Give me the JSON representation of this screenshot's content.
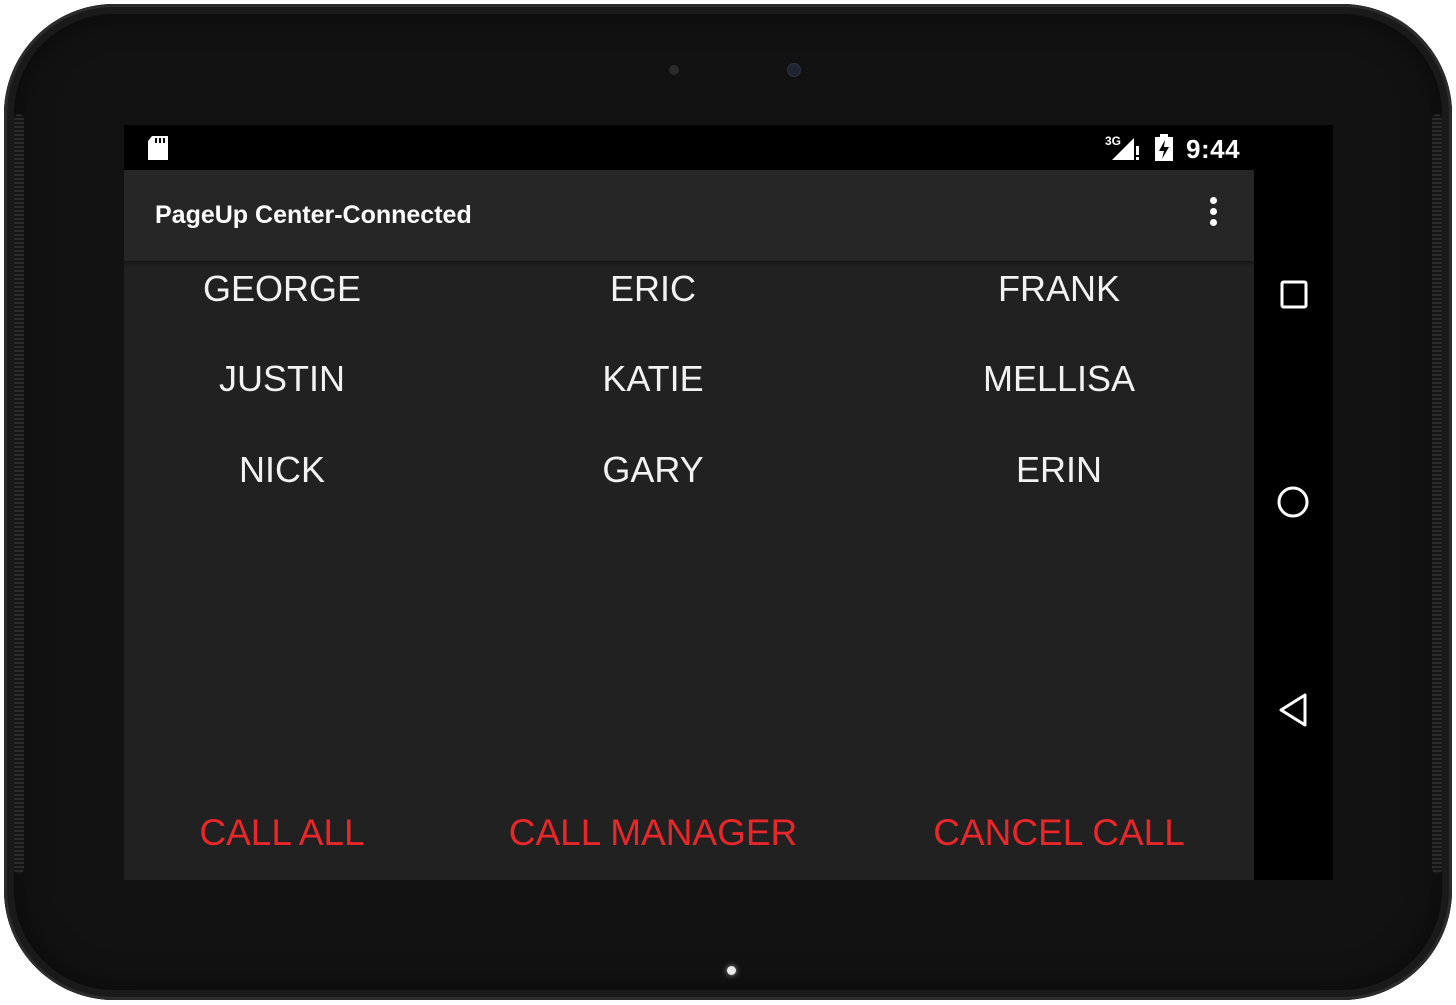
{
  "status_bar": {
    "network": "3G",
    "time": "9:44",
    "icons": [
      "sd-card-icon",
      "signal-3g-icon",
      "battery-charging-icon"
    ]
  },
  "action_bar": {
    "title": "PageUp Center-Connected",
    "menu_icon": "overflow-menu-icon"
  },
  "contacts": [
    "GEORGE",
    "ERIC",
    "FRANK",
    "JUSTIN",
    "KATIE",
    "MELLISA",
    "NICK",
    "GARY",
    "ERIN"
  ],
  "actions": {
    "call_all": "CALL ALL",
    "call_manager": "CALL MANAGER",
    "cancel_call": "CANCEL CALL"
  },
  "navigation": [
    "recents-icon",
    "home-icon",
    "back-icon"
  ],
  "colors": {
    "background": "#212121",
    "action_bar": "#262626",
    "contact_text": "#f2f2f2",
    "action_text": "#e8272b"
  }
}
